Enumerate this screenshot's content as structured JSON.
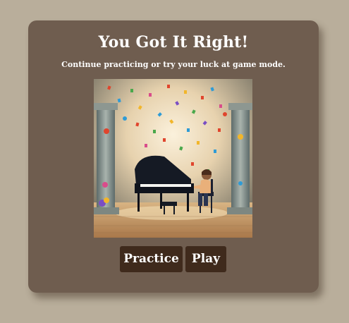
{
  "modal": {
    "title": "You Got It Right!",
    "subtitle": "Continue practicing or try your luck at game mode."
  },
  "illustration": {
    "icon": "child-playing-grand-piano-with-confetti-illustration"
  },
  "buttons": {
    "practice_label": "Practice",
    "play_label": "Play"
  },
  "colors": {
    "page_background": "#b9ae9b",
    "card_background": "#6f5d4f",
    "button_background": "#3f2a1c",
    "text": "#ffffff"
  }
}
